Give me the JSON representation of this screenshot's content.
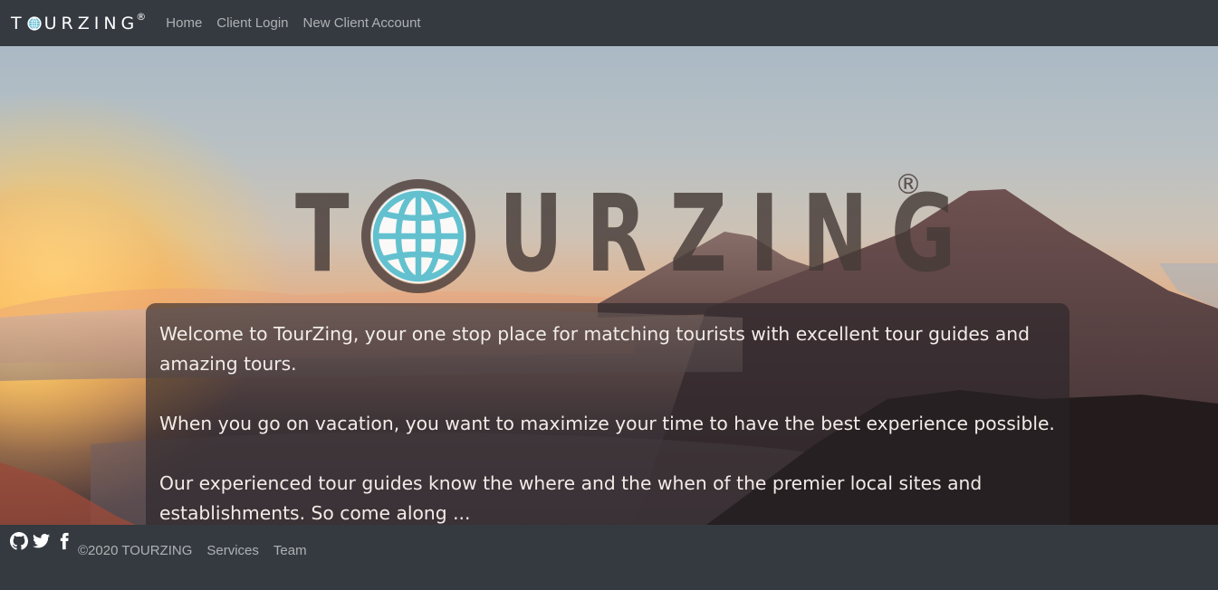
{
  "navbar": {
    "brand_left": "T",
    "brand_right": "URZING",
    "brand_reg": "®",
    "links": [
      {
        "label": "Home"
      },
      {
        "label": "Client Login"
      },
      {
        "label": "New Client Account"
      }
    ]
  },
  "hero": {
    "logo_left": "T",
    "logo_right": "URZING",
    "logo_reg": "®",
    "paragraphs": [
      "Welcome to TourZing, your one stop place for matching tourists with excellent tour guides and amazing tours.",
      "When you go on vacation, you want to maximize your time to have the best experience possible.",
      "Our experienced tour guides know the where and the when of the premier local sites and establishments. So come along ..."
    ]
  },
  "footer": {
    "copyright": "©2020 TOURZING",
    "links": [
      {
        "label": "Services"
      },
      {
        "label": "Team"
      }
    ]
  },
  "colors": {
    "navbar_bg": "#343a40",
    "globe_fill": "#63c1cf",
    "globe_ring": "#5a4a45"
  }
}
